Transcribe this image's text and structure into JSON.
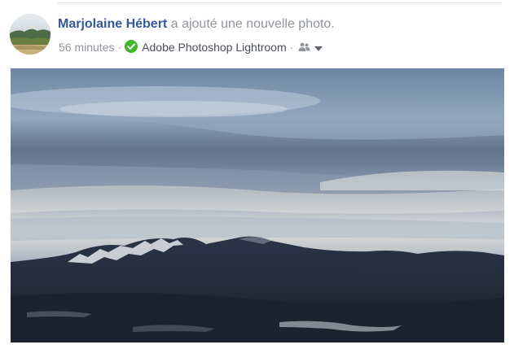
{
  "post": {
    "author": "Marjolaine Hébert",
    "action": "a ajouté une nouvelle photo.",
    "timestamp": "56 minutes",
    "separator": "·",
    "app": "Adobe Photoshop Lightroom",
    "audience_icon": "friends-icon",
    "menu_icon": "caret-down-icon",
    "verified_icon": "green-check-icon",
    "photo_subject": "mountain-landscape-photo"
  },
  "colors": {
    "author": "#365899",
    "meta": "#90949c",
    "verified": "#42b72a"
  }
}
